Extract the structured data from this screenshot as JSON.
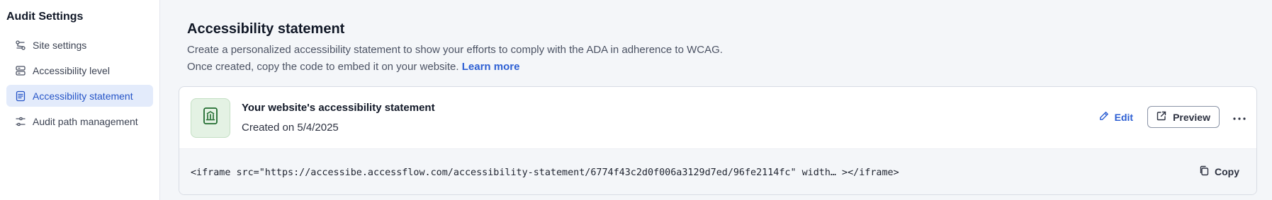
{
  "sidebar": {
    "title": "Audit Settings",
    "items": [
      {
        "label": "Site settings",
        "icon": "site-settings-icon",
        "active": false
      },
      {
        "label": "Accessibility level",
        "icon": "layers-icon",
        "active": false
      },
      {
        "label": "Accessibility statement",
        "icon": "document-icon",
        "active": true
      },
      {
        "label": "Audit path management",
        "icon": "sliders-icon",
        "active": false
      }
    ]
  },
  "main": {
    "title": "Accessibility statement",
    "description_line1": "Create a personalized accessibility statement to show your efforts to comply with the ADA in adherence to WCAG.",
    "description_line2": "Once created, copy the code to embed it on your website.",
    "learn_more": "Learn more"
  },
  "card": {
    "title": "Your website's accessibility statement",
    "created": "Created on 5/4/2025",
    "edit_label": "Edit",
    "preview_label": "Preview",
    "code": "<iframe src=\"https://accessibe.accessflow.com/accessibility-statement/6774f43c2d0f006a3129d7ed/96fe2114fc\" width… ></iframe>",
    "copy_label": "Copy"
  },
  "colors": {
    "accent": "#2d5fd3",
    "active_bg": "#e3ebfb",
    "badge_bg": "#e4f2e4",
    "badge_icon": "#1f6b2e"
  }
}
